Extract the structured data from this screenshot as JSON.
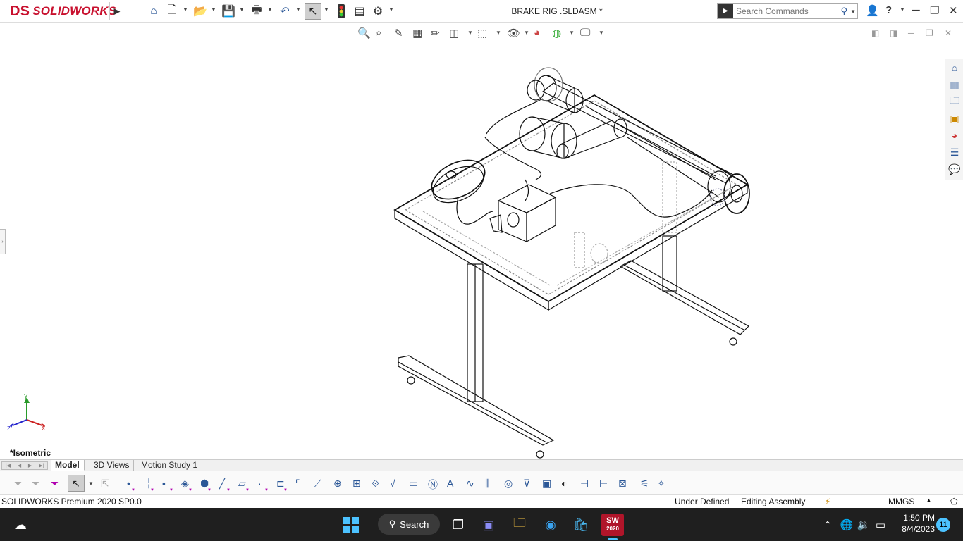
{
  "app": {
    "brand": "SOLIDWORKS",
    "brand_prefix": "DS",
    "document_title": "BRAKE RIG .SLDASM *"
  },
  "search": {
    "placeholder": "Search Commands"
  },
  "toolbar": {
    "icons": [
      "home-icon",
      "new-document-icon",
      "open-icon",
      "save-icon",
      "print-icon",
      "undo-icon",
      "select-icon",
      "rebuild-icon",
      "file-properties-icon",
      "options-icon"
    ]
  },
  "help": {
    "label": "?"
  },
  "viewport": {
    "view_name": "*Isometric",
    "triad": {
      "x": "X",
      "y": "Y",
      "z": "Z"
    }
  },
  "model_tabs": [
    {
      "label": "Model",
      "active": true
    },
    {
      "label": "3D Views",
      "active": false
    },
    {
      "label": "Motion Study 1",
      "active": false
    }
  ],
  "status_bar": {
    "product": "SOLIDWORKS Premium 2020 SP0.0",
    "definition": "Under Defined",
    "mode": "Editing Assembly",
    "units": "MMGS"
  },
  "taskbar": {
    "search_label": "Search",
    "solidworks_badge": "2020",
    "time": "1:50 PM",
    "date": "8/4/2023",
    "notifications": "11"
  },
  "colors": {
    "brand_red": "#c8102e",
    "icon_blue": "#2b5797",
    "taskbar_bg": "#1f1f1f",
    "edge": "#111111"
  }
}
